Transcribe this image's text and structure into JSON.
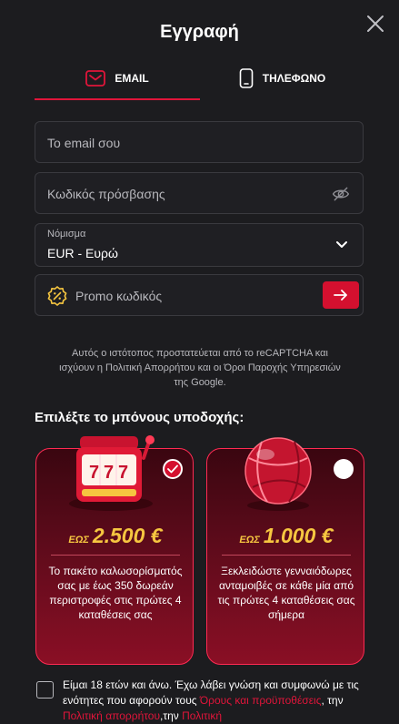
{
  "title": "Εγγραφή",
  "tabs": {
    "email": "EMAIL",
    "phone": "ΤΗΛΕΦΩΝΟ"
  },
  "form": {
    "email_placeholder": "Το email σου",
    "password_placeholder": "Κωδικός πρόσβασης",
    "currency_label": "Νόμισμα",
    "currency_value": "EUR - Ευρώ",
    "promo_placeholder": "Promo κωδικός"
  },
  "recaptcha": "Αυτός ο ιστότοπος προστατεύεται από το reCAPTCHA και ισχύουν η Πολιτική Απορρήτου και οι Όροι Παροχής Υπηρεσιών της Google.",
  "bonus": {
    "heading": "Επιλέξτε το μπόνους υποδοχής:",
    "cards": [
      {
        "prefix": "ΕΩΣ",
        "amount": "2.500 €",
        "desc": "Το πακέτο καλωσορίσματός σας με έως 350 δωρεάν περιστροφές στις πρώτες 4 καταθέσεις σας",
        "selected": true
      },
      {
        "prefix": "ΕΩΣ",
        "amount": "1.000 €",
        "desc": "Ξεκλειδώστε γενναιόδωρες ανταμοιβές σε κάθε μία από τις πρώτες 4 καταθέσεις σας σήμερα",
        "selected": false
      }
    ]
  },
  "terms": {
    "text1": "Είμαι 18 ετών και άνω. Έχω λάβει γνώση και συμφωνώ με τις ενότητες που αφορούν τους ",
    "link1": "Όρους και προϋποθέσεις",
    "text2": ", την ",
    "link2": "Πολιτική απορρήτου",
    "text3": ",την ",
    "link3": "Πολιτική"
  },
  "colors": {
    "accent": "#d4102f",
    "gold": "#f6c640",
    "background": "#1c1c1f"
  },
  "icons": [
    "close-icon",
    "mail-icon",
    "phone-icon",
    "eye-off-icon",
    "chevron-down-icon",
    "promo-badge-icon",
    "arrow-right-icon",
    "checkmark-icon"
  ]
}
